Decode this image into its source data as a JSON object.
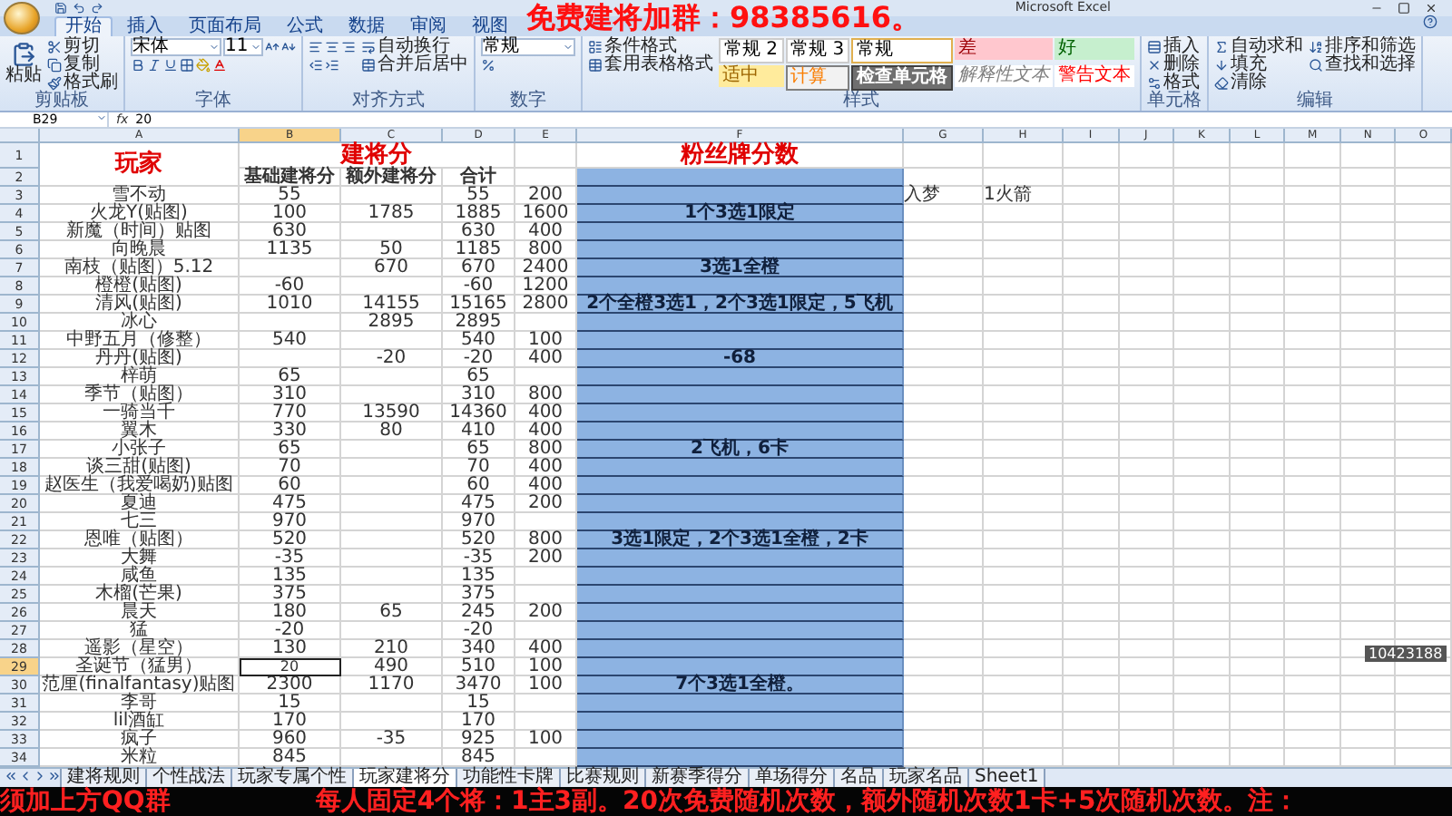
{
  "window": {
    "title": "Microsoft Excel"
  },
  "overlay_top": "免费建将加群：98385616。",
  "stream_id": "10423188",
  "ticker": [
    "须加上方QQ群",
    "每人固定4个将：1主3副。20次免费随机次数，额外随机次数1卡+5次随机次数。注："
  ],
  "ribbon": {
    "tabs": [
      {
        "label": "开始",
        "selected": true
      },
      {
        "label": "插入",
        "selected": false
      },
      {
        "label": "页面布局",
        "selected": false
      },
      {
        "label": "公式",
        "selected": false
      },
      {
        "label": "数据",
        "selected": false
      },
      {
        "label": "审阅",
        "selected": false
      },
      {
        "label": "视图",
        "selected": false
      }
    ],
    "groups": [
      {
        "label": "剪贴板",
        "kind": "clipboard",
        "big": [
          {
            "label": "粘贴"
          }
        ],
        "small": [
          {
            "label": "剪切"
          },
          {
            "label": "复制"
          },
          {
            "label": "格式刷"
          }
        ]
      },
      {
        "label": "字体",
        "kind": "font",
        "font": "宋体",
        "size": "11"
      },
      {
        "label": "对齐方式",
        "kind": "align",
        "small": [
          {
            "label": "自动换行"
          },
          {
            "label": "合并后居中"
          }
        ]
      },
      {
        "label": "数字",
        "kind": "number",
        "format": "常规"
      },
      {
        "label": "样式",
        "kind": "styles",
        "small": [
          {
            "label": "条件格式"
          },
          {
            "label": "套用表格格式"
          }
        ],
        "gallery": [
          {
            "label": "常规 2",
            "kind": "normal"
          },
          {
            "label": "常规 3",
            "kind": "normal"
          },
          {
            "label": "常规",
            "kind": "normal_selected"
          },
          {
            "label": "差",
            "kind": "bad"
          },
          {
            "label": "好",
            "kind": "good"
          },
          {
            "label": "适中",
            "kind": "neutral"
          },
          {
            "label": "计算",
            "kind": "calc"
          },
          {
            "label": "检查单元格",
            "kind": "check"
          },
          {
            "label": "解释性文本",
            "kind": "explain"
          },
          {
            "label": "警告文本",
            "kind": "warning"
          }
        ]
      },
      {
        "label": "单元格",
        "kind": "cells",
        "small": [
          {
            "label": "插入"
          },
          {
            "label": "删除"
          },
          {
            "label": "格式"
          }
        ]
      },
      {
        "label": "编辑",
        "kind": "edit",
        "small": [
          {
            "label": "自动求和"
          },
          {
            "label": "填充"
          },
          {
            "label": "清除"
          },
          {
            "label": "排序和筛选"
          },
          {
            "label": "查找和选择"
          }
        ]
      }
    ]
  },
  "formula_bar": {
    "name_box": "B29",
    "function_label": "fx",
    "formula": "20"
  },
  "sheet": {
    "columns": [
      {
        "letter": "A",
        "selected": false
      },
      {
        "letter": "B",
        "selected": true
      },
      {
        "letter": "C",
        "selected": false
      },
      {
        "letter": "D",
        "selected": false
      },
      {
        "letter": "E",
        "selected": false
      },
      {
        "letter": "F",
        "selected": false
      },
      {
        "letter": "G",
        "selected": false
      },
      {
        "letter": "H",
        "selected": false
      },
      {
        "letter": "I",
        "selected": false
      },
      {
        "letter": "J",
        "selected": false
      },
      {
        "letter": "K",
        "selected": false
      },
      {
        "letter": "L",
        "selected": false
      },
      {
        "letter": "M",
        "selected": false
      },
      {
        "letter": "N",
        "selected": false
      },
      {
        "letter": "O",
        "selected": false
      }
    ],
    "rows": [
      {
        "number": "1",
        "kind": "title",
        "selected": false,
        "cells": {
          "A": "玩家",
          "B": "建将分",
          "F": "粉丝牌分数"
        }
      },
      {
        "number": "2",
        "kind": "subhead",
        "selected": false,
        "cells": {
          "B": "基础建将分",
          "C": "额外建将分",
          "D": "合计"
        }
      },
      {
        "number": "3",
        "kind": "data",
        "selected": false,
        "cells": {
          "A": "雪不动",
          "B": "55",
          "D": "55",
          "E": "200",
          "G": "入梦",
          "H": "1火箭"
        }
      },
      {
        "number": "4",
        "kind": "data",
        "selected": false,
        "cells": {
          "A": "火龙Y(贴图)",
          "B": "100",
          "C": "1785",
          "D": "1885",
          "E": "1600",
          "F": "1个3选1限定"
        }
      },
      {
        "number": "5",
        "kind": "data",
        "selected": false,
        "cells": {
          "A": "新魔（时间）贴图",
          "B": "630",
          "D": "630",
          "E": "400"
        }
      },
      {
        "number": "6",
        "kind": "data",
        "selected": false,
        "cells": {
          "A": "向晚晨",
          "B": "1135",
          "C": "50",
          "D": "1185",
          "E": "800"
        }
      },
      {
        "number": "7",
        "kind": "data",
        "selected": false,
        "cells": {
          "A": "南枝（贴图）5.12",
          "C": "670",
          "D": "670",
          "E": "2400",
          "F": "3选1全橙"
        }
      },
      {
        "number": "8",
        "kind": "data",
        "selected": false,
        "cells": {
          "A": "橙橙(贴图)",
          "B": "-60",
          "D": "-60",
          "E": "1200"
        }
      },
      {
        "number": "9",
        "kind": "data",
        "selected": false,
        "cells": {
          "A": "清风(贴图)",
          "B": "1010",
          "C": "14155",
          "D": "15165",
          "E": "2800",
          "F": "2个全橙3选1，2个3选1限定，5飞机"
        }
      },
      {
        "number": "10",
        "kind": "data",
        "selected": false,
        "cells": {
          "A": "冰心",
          "C": "2895",
          "D": "2895"
        }
      },
      {
        "number": "11",
        "kind": "data",
        "selected": false,
        "cells": {
          "A": "中野五月（修整）",
          "B": "540",
          "D": "540",
          "E": "100"
        }
      },
      {
        "number": "12",
        "kind": "data",
        "selected": false,
        "cells": {
          "A": "丹丹(贴图)",
          "C": "-20",
          "D": "-20",
          "E": "400",
          "F": "-68"
        }
      },
      {
        "number": "13",
        "kind": "data",
        "selected": false,
        "cells": {
          "A": "梓萌",
          "B": "65",
          "D": "65"
        }
      },
      {
        "number": "14",
        "kind": "data",
        "selected": false,
        "cells": {
          "A": "季节（贴图）",
          "B": "310",
          "D": "310",
          "E": "800"
        }
      },
      {
        "number": "15",
        "kind": "data",
        "selected": false,
        "cells": {
          "A": "一骑当千",
          "B": "770",
          "C": "13590",
          "D": "14360",
          "E": "400"
        }
      },
      {
        "number": "16",
        "kind": "data",
        "selected": false,
        "cells": {
          "A": "翼木",
          "B": "330",
          "C": "80",
          "D": "410",
          "E": "400"
        }
      },
      {
        "number": "17",
        "kind": "data",
        "selected": false,
        "cells": {
          "A": "小张子",
          "B": "65",
          "D": "65",
          "E": "800",
          "F": "2飞机，6卡"
        }
      },
      {
        "number": "18",
        "kind": "data",
        "selected": false,
        "cells": {
          "A": "谈三甜(贴图)",
          "B": "70",
          "D": "70",
          "E": "400"
        }
      },
      {
        "number": "19",
        "kind": "data",
        "selected": false,
        "cells": {
          "A": "赵医生（我爱喝奶)贴图",
          "B": "60",
          "D": "60",
          "E": "400"
        }
      },
      {
        "number": "20",
        "kind": "data",
        "selected": false,
        "cells": {
          "A": "夏迪",
          "B": "475",
          "D": "475",
          "E": "200"
        }
      },
      {
        "number": "21",
        "kind": "data",
        "selected": false,
        "cells": {
          "A": "七三",
          "B": "970",
          "D": "970"
        }
      },
      {
        "number": "22",
        "kind": "data",
        "selected": false,
        "cells": {
          "A": "恩唯（贴图）",
          "B": "520",
          "D": "520",
          "E": "800",
          "F": "3选1限定，2个3选1全橙，2卡"
        }
      },
      {
        "number": "23",
        "kind": "data",
        "selected": false,
        "cells": {
          "A": "大舞",
          "B": "-35",
          "D": "-35",
          "E": "200"
        }
      },
      {
        "number": "24",
        "kind": "data",
        "selected": false,
        "cells": {
          "A": "咸鱼",
          "B": "135",
          "D": "135"
        }
      },
      {
        "number": "25",
        "kind": "data",
        "selected": false,
        "cells": {
          "A": "木榴(芒果)",
          "B": "375",
          "D": "375"
        }
      },
      {
        "number": "26",
        "kind": "data",
        "selected": false,
        "cells": {
          "A": "晨天",
          "B": "180",
          "C": "65",
          "D": "245",
          "E": "200"
        }
      },
      {
        "number": "27",
        "kind": "data",
        "selected": false,
        "cells": {
          "A": "猛",
          "B": "-20",
          "D": "-20"
        }
      },
      {
        "number": "28",
        "kind": "data",
        "selected": false,
        "cells": {
          "A": "遥影（星空）",
          "B": "130",
          "C": "210",
          "D": "340",
          "E": "400"
        }
      },
      {
        "number": "29",
        "kind": "data",
        "selected": true,
        "cells": {
          "A": "圣诞节（猛男）",
          "B": "20",
          "C": "490",
          "D": "510",
          "E": "100"
        }
      },
      {
        "number": "30",
        "kind": "data",
        "selected": false,
        "cells": {
          "A": "范厘(finalfantasy)贴图",
          "B": "2300",
          "C": "1170",
          "D": "3470",
          "E": "100",
          "F": "7个3选1全橙。"
        }
      },
      {
        "number": "31",
        "kind": "data",
        "selected": false,
        "cells": {
          "A": "李哥",
          "B": "15",
          "D": "15"
        }
      },
      {
        "number": "32",
        "kind": "data",
        "selected": false,
        "cells": {
          "A": "lil酒缸",
          "B": "170",
          "D": "170"
        }
      },
      {
        "number": "33",
        "kind": "data",
        "selected": false,
        "cells": {
          "A": "疯子",
          "B": "960",
          "C": "-35",
          "D": "925",
          "E": "100"
        }
      },
      {
        "number": "34",
        "kind": "data",
        "selected": false,
        "cells": {
          "A": "米粒",
          "B": "845",
          "D": "845"
        }
      }
    ]
  },
  "sheet_tabs": [
    {
      "label": "建将规则",
      "selected": false
    },
    {
      "label": "个性战法",
      "selected": false
    },
    {
      "label": "玩家专属个性",
      "selected": false
    },
    {
      "label": "玩家建将分",
      "selected": true
    },
    {
      "label": "功能性卡牌",
      "selected": false
    },
    {
      "label": "比赛规则",
      "selected": false
    },
    {
      "label": "新赛季得分",
      "selected": false
    },
    {
      "label": "单场得分",
      "selected": false
    },
    {
      "label": "名品",
      "selected": false
    },
    {
      "label": "玩家名品",
      "selected": false
    },
    {
      "label": "Sheet1",
      "selected": false
    }
  ]
}
